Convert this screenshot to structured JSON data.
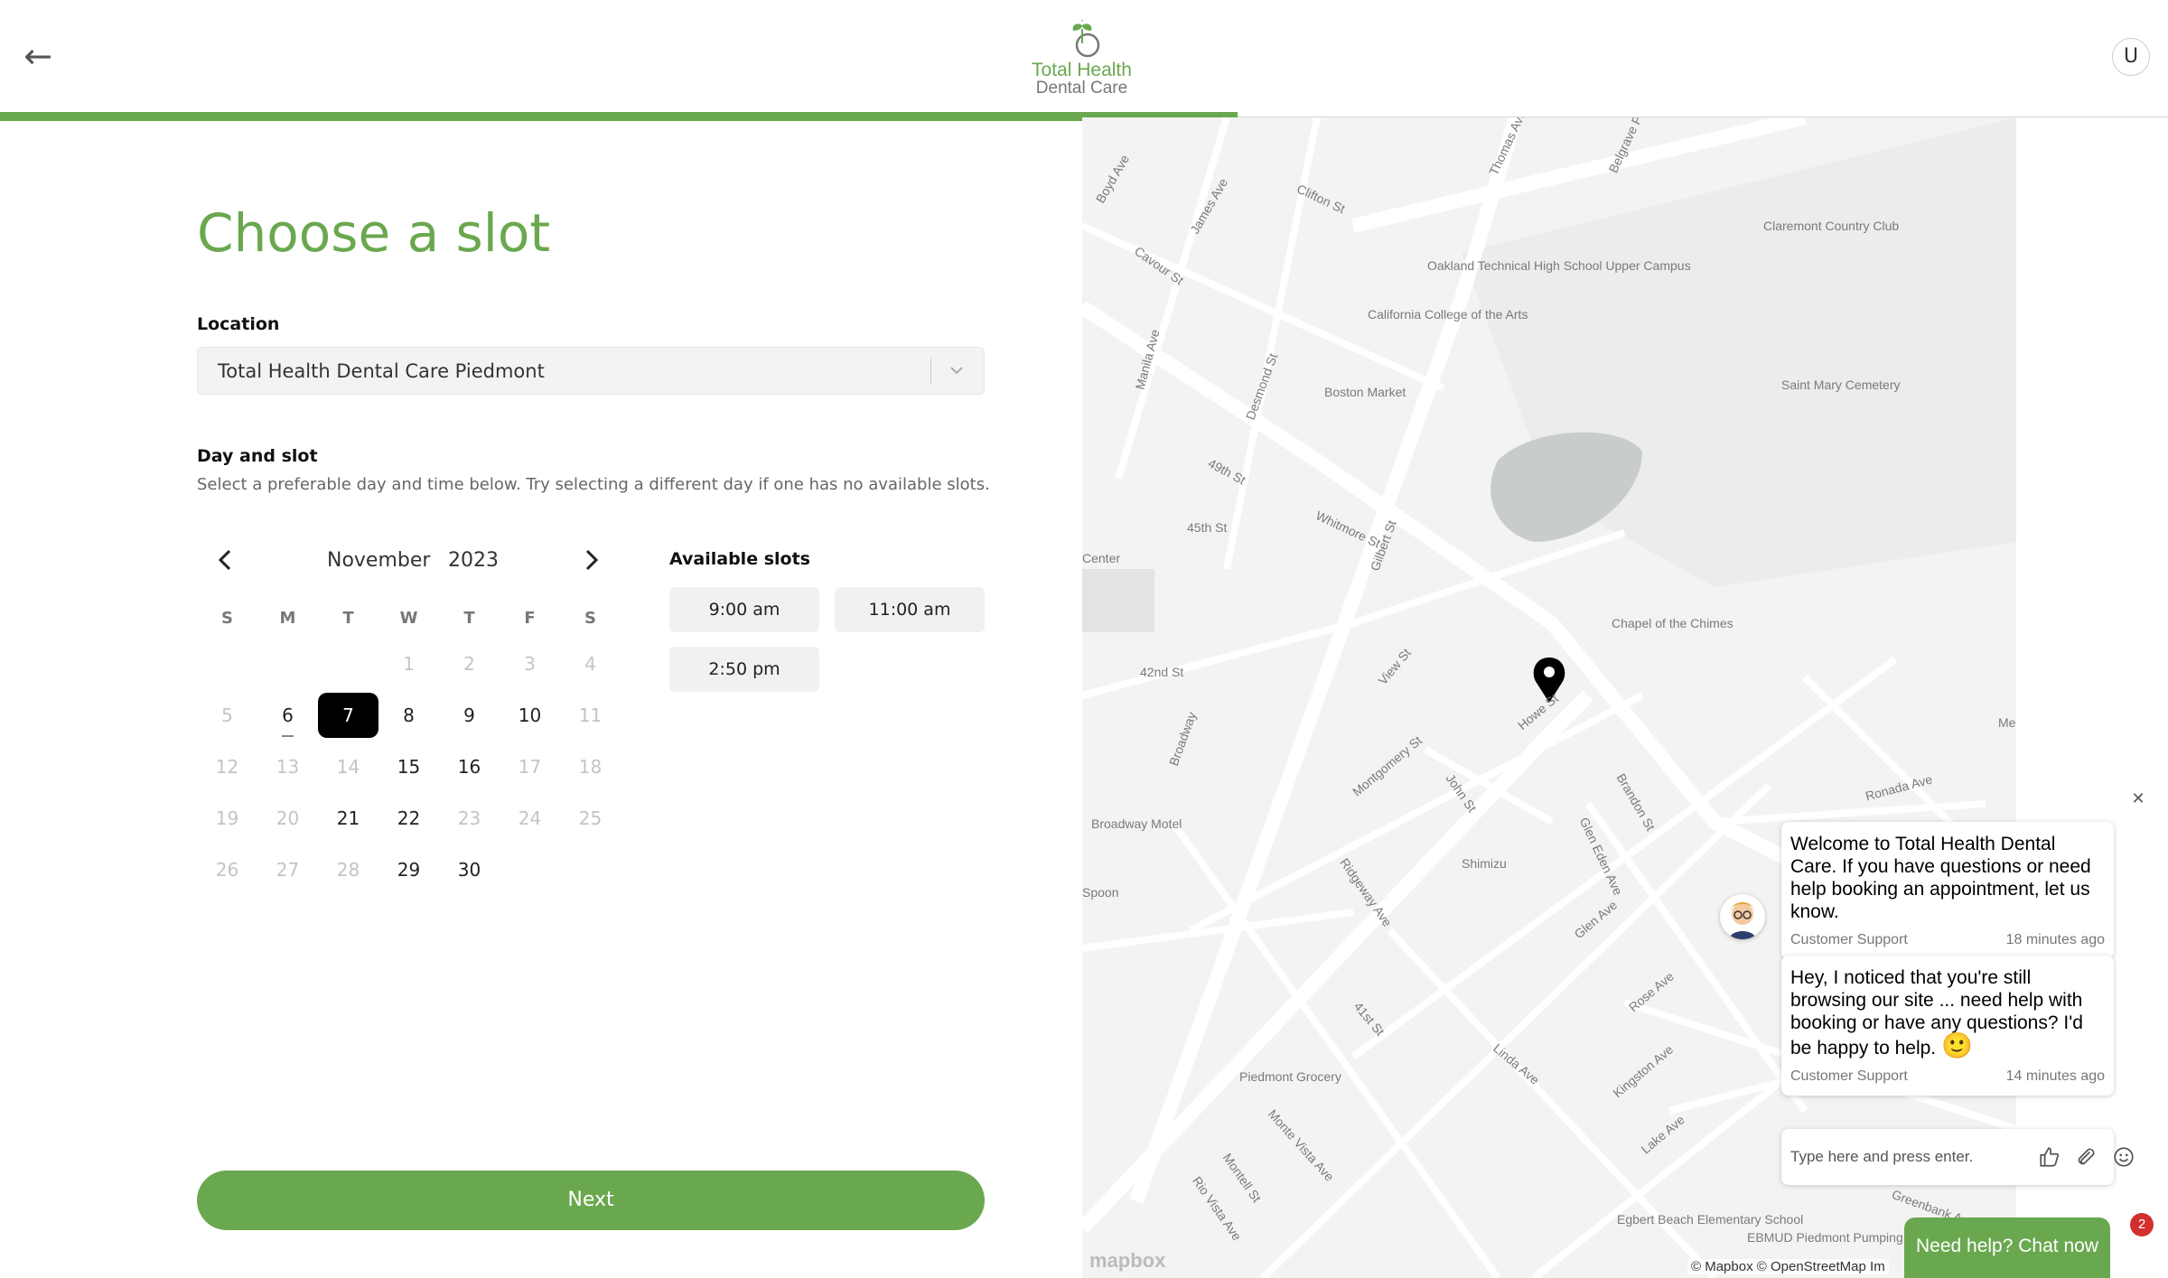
{
  "header": {
    "logo_line1": "Total Health",
    "logo_line2": "Dental Care",
    "avatar_initial": "U",
    "progress_fraction": 0.571
  },
  "page": {
    "title": "Choose a slot",
    "location_label": "Location",
    "location_value": "Total Health Dental Care Piedmont",
    "day_slot_label": "Day and slot",
    "helper_text": "Select a preferable day and time below. Try selecting a different day if one has no available slots.",
    "next_label": "Next"
  },
  "calendar": {
    "month": "November",
    "year": "2023",
    "weekdays": [
      "S",
      "M",
      "T",
      "W",
      "T",
      "F",
      "S"
    ],
    "weeks": [
      [
        {
          "d": ""
        },
        {
          "d": ""
        },
        {
          "d": ""
        },
        {
          "d": "1",
          "s": "disabled"
        },
        {
          "d": "2",
          "s": "disabled"
        },
        {
          "d": "3",
          "s": "disabled"
        },
        {
          "d": "4",
          "s": "disabled"
        }
      ],
      [
        {
          "d": "5",
          "s": "disabled"
        },
        {
          "d": "6",
          "s": "today"
        },
        {
          "d": "7",
          "s": "selected"
        },
        {
          "d": "8",
          "s": "available"
        },
        {
          "d": "9",
          "s": "available"
        },
        {
          "d": "10",
          "s": "available"
        },
        {
          "d": "11",
          "s": "disabled"
        }
      ],
      [
        {
          "d": "12",
          "s": "disabled"
        },
        {
          "d": "13",
          "s": "disabled"
        },
        {
          "d": "14",
          "s": "disabled"
        },
        {
          "d": "15",
          "s": "available"
        },
        {
          "d": "16",
          "s": "available"
        },
        {
          "d": "17",
          "s": "disabled"
        },
        {
          "d": "18",
          "s": "disabled"
        }
      ],
      [
        {
          "d": "19",
          "s": "disabled"
        },
        {
          "d": "20",
          "s": "disabled"
        },
        {
          "d": "21",
          "s": "available"
        },
        {
          "d": "22",
          "s": "available"
        },
        {
          "d": "23",
          "s": "disabled"
        },
        {
          "d": "24",
          "s": "disabled"
        },
        {
          "d": "25",
          "s": "disabled"
        }
      ],
      [
        {
          "d": "26",
          "s": "disabled"
        },
        {
          "d": "27",
          "s": "disabled"
        },
        {
          "d": "28",
          "s": "disabled"
        },
        {
          "d": "29",
          "s": "available"
        },
        {
          "d": "30",
          "s": "available"
        },
        {
          "d": ""
        },
        {
          "d": ""
        }
      ]
    ]
  },
  "slots": {
    "label": "Available slots",
    "items": [
      "9:00 am",
      "11:00 am",
      "2:50 pm"
    ]
  },
  "map": {
    "labels": [
      "Oakland Technical High School Upper Campus",
      "Claremont Country Club",
      "California College of the Arts",
      "Boston Market",
      "Saint Mary Cemetery",
      "Chapel of the Chimes",
      "Broadway Motel",
      "Shimizu",
      "Piedmont Grocery",
      "Egbert Beach Elementary School",
      "EBMUD Piedmont Pumping Plant",
      "Broadway",
      "Clifton St",
      "Cavour St",
      "James Ave",
      "Manila Ave",
      "Desmond St",
      "49th St",
      "45th St",
      "Whitmore St",
      "Gilbert St",
      "42nd St",
      "View St",
      "Howe St",
      "John St",
      "Montgomery St",
      "Brandon St",
      "Ronada Ave",
      "Glen Eden Ave",
      "Glen Ave",
      "Ridgeway Ave",
      "Rose Ave",
      "41st St",
      "Linda Ave",
      "Kingston Ave",
      "Lake Ave",
      "Monte Vista Ave",
      "Montell St",
      "Rio Vista Ave",
      "Greenbank Ave",
      "Thomas Ave",
      "Belgrave Pl",
      "Boyd Ave",
      "Center",
      "Spoon",
      "Me"
    ],
    "attribution": "© Mapbox © OpenStreetMap  Im",
    "logo_text": "mapbox"
  },
  "chat": {
    "messages": [
      {
        "text": "Welcome to Total Health Dental Care. If you have questions or need help booking an appointment, let us know.",
        "sender": "Customer Support",
        "time": "18 minutes ago"
      },
      {
        "text": "Hey, I noticed that you're still browsing our site ... need help with booking or have any questions? I'd be happy to help.",
        "emoji": "🙂",
        "sender": "Customer Support",
        "time": "14 minutes ago"
      }
    ],
    "input_placeholder": "Type here and press enter.",
    "launcher_label": "Need help? Chat now",
    "unread_count": "2"
  },
  "colors": {
    "brand_green": "#6aa84f",
    "selected_day": "#000000",
    "badge_red": "#d32f2f"
  },
  "icons": [
    "back-arrow-icon",
    "chevron-down-icon",
    "chevron-left-icon",
    "chevron-right-icon",
    "map-pin-icon",
    "close-icon",
    "thumbs-up-icon",
    "paperclip-icon",
    "smiley-icon"
  ]
}
